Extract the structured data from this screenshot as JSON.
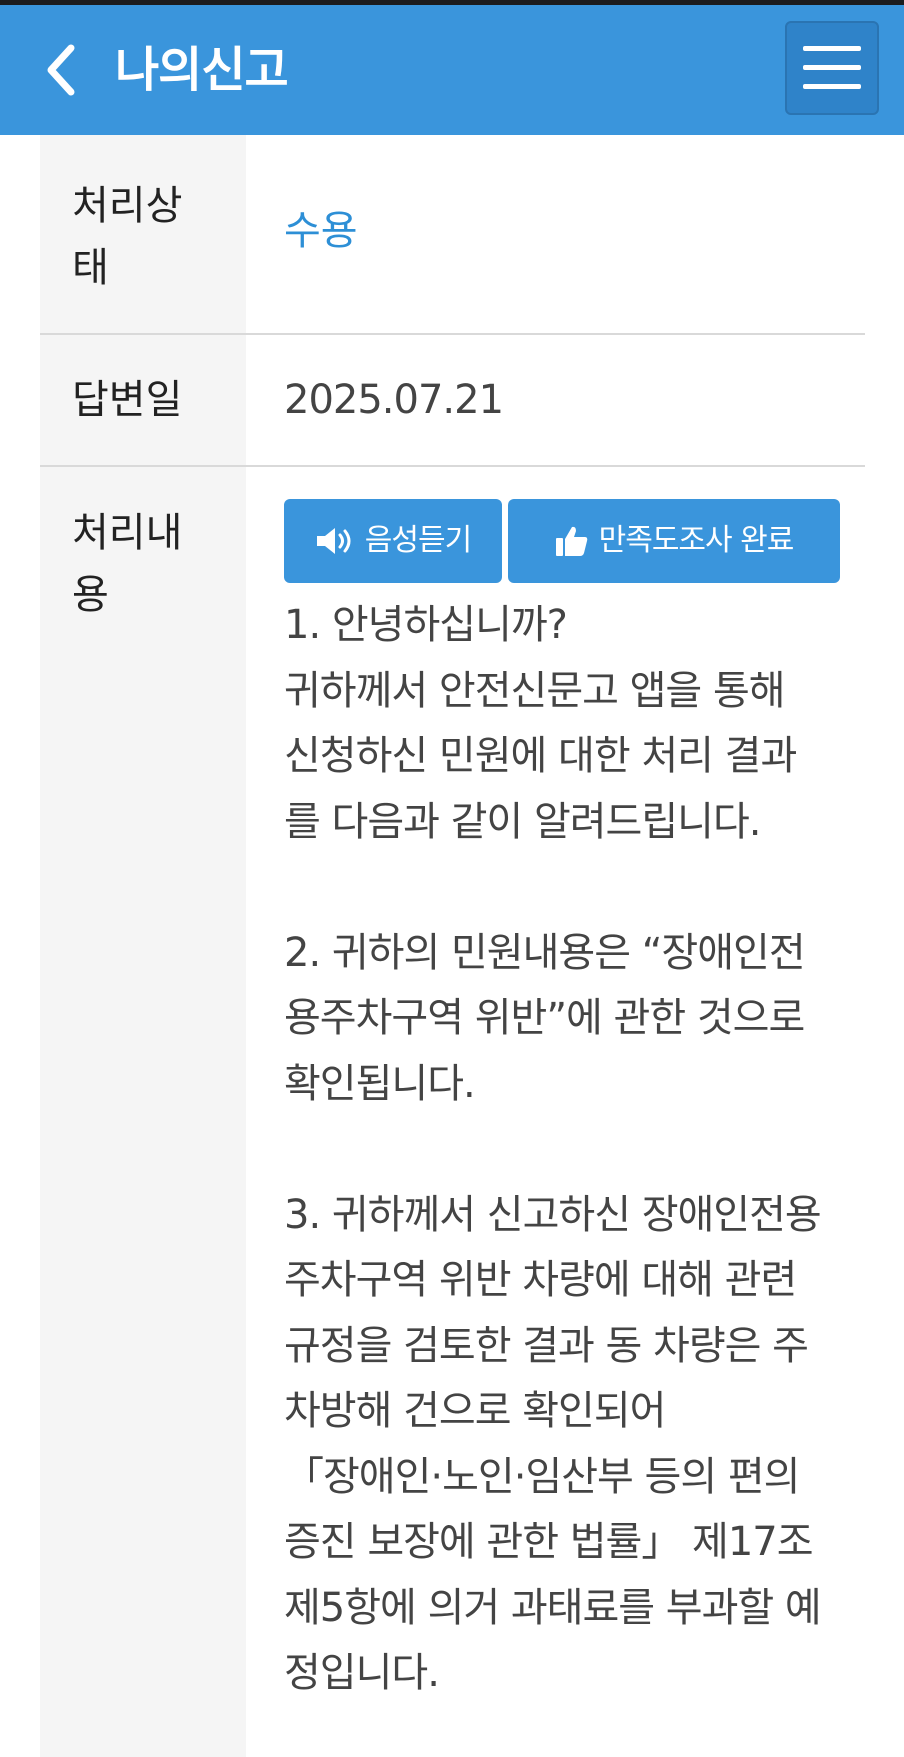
{
  "header": {
    "title": "나의신고",
    "back_icon": "chevron-left-icon",
    "menu_icon": "hamburger-menu-icon",
    "colors": {
      "bar": "#3a95dc",
      "menu_button": "#2f83c9"
    }
  },
  "details": {
    "status_label": "처리상\n태",
    "status_value": "수용",
    "status_color": "#2d8fd6",
    "answer_date_label": "답변일",
    "answer_date_value": "2025.07.21",
    "content_label": "처리내\n용"
  },
  "actions": {
    "voice_label": "음성듣기",
    "voice_icon": "speaker-icon",
    "survey_label": "만족도조사 완료",
    "survey_icon": "thumbs-up-icon"
  },
  "body": {
    "text": "1. 안녕하십니까?\n귀하께서 안전신문고 앱을 통해\n신청하신 민원에 대한 처리 결과\n를 다음과 같이 알려드립니다.\n\n2. 귀하의 민원내용은 “장애인전\n용주차구역 위반”에 관한 것으로\n확인됩니다.\n\n3. 귀하께서 신고하신 장애인전용\n주차구역 위반 차량에 대해 관련\n규정을 검토한 결과 동 차량은 주\n차방해 건으로 확인되어\n「장애인·노인·임산부 등의 편의\n증진 보장에 관한 법률」 제17조\n제5항에 의거 과태료를 부과할 예\n정입니다."
  }
}
